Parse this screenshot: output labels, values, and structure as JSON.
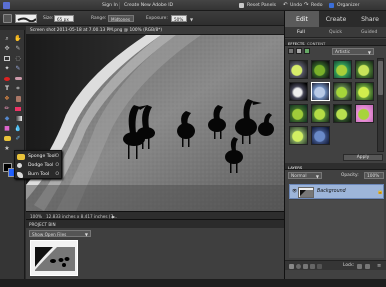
{
  "topbar": {
    "sign_in": "Sign In",
    "create_id": "Create New Adobe ID",
    "reset_panels": "Reset Panels",
    "undo": "Undo",
    "redo": "Redo",
    "organizer": "Organizer"
  },
  "options": {
    "size_label": "Size:",
    "size_value": "65 px",
    "range_label": "Range:",
    "range_value": "Midtones",
    "exposure_label": "Exposure:",
    "exposure_value": "50%"
  },
  "document": {
    "tab_title": "Screen shot 2011-05-18 at 7.00.13 PM.png @ 100% (RGB/8*)",
    "zoom": "100%",
    "dimensions": "12.833 inches x 8.417 inches (7..."
  },
  "tool_flyout": {
    "items": [
      "Sponge Tool",
      "Dodge Tool",
      "Burn Tool"
    ],
    "shortcuts": [
      "O",
      "O",
      "O"
    ]
  },
  "project_bin": {
    "header": "PROJECT BIN",
    "dropdown": "Show Open Files"
  },
  "right_panel": {
    "tabs": [
      "Edit",
      "Create",
      "Share"
    ],
    "subtabs": [
      "Full",
      "Quick",
      "Guided"
    ],
    "effects_header": "EFFECTS",
    "content_header": "CONTENT",
    "filter_dropdown": "Artistic",
    "apply_button": "Apply",
    "layers_header": "LAYERS",
    "blend_mode": "Normal",
    "opacity_label": "Opacity:",
    "opacity_value": "100%",
    "layer_name": "Background",
    "lock_label": "Lock:"
  },
  "colors": {
    "accent_blue": "#9db5da",
    "foreground": "#000000",
    "background": "#2060ff",
    "active_tab": "#5a5a5a"
  },
  "icons": [
    "brush-icon",
    "eye-icon",
    "lock-icon",
    "undo-icon",
    "redo-icon",
    "organizer-icon",
    "reset-icon",
    "sponge-icon",
    "dodge-icon",
    "burn-icon",
    "trash-icon"
  ]
}
